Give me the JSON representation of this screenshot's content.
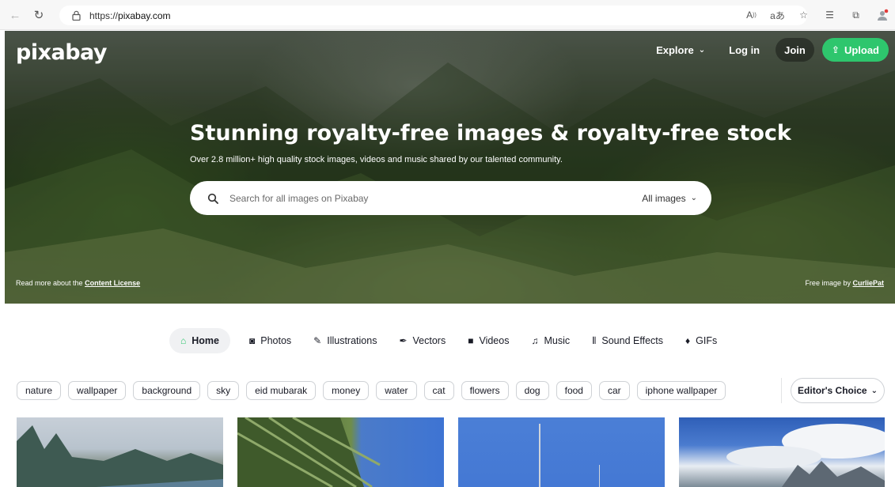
{
  "browser": {
    "url_prefix": "https://",
    "url_host": "pixabay.com",
    "icons": [
      "read-aloud-icon",
      "translate-icon",
      "favorite-star-icon",
      "favorites-list-icon",
      "collections-icon",
      "profile-icon"
    ]
  },
  "header": {
    "logo": "pixabay",
    "explore_label": "Explore",
    "login_label": "Log in",
    "join_label": "Join",
    "upload_label": "Upload"
  },
  "hero": {
    "title": "Stunning royalty-free images & royalty-free stock",
    "subtitle": "Over 2.8 million+ high quality stock images, videos and music shared by our talented community.",
    "search_placeholder": "Search for all images on Pixabay",
    "search_scope": "All images",
    "license_prefix": "Read more about the",
    "license_link": "Content License",
    "credit_prefix": "Free image by",
    "credit_link": "CurliePat"
  },
  "tabs": [
    {
      "label": "Home",
      "icon": "home-icon",
      "active": true
    },
    {
      "label": "Photos",
      "icon": "camera-icon",
      "active": false
    },
    {
      "label": "Illustrations",
      "icon": "brush-icon",
      "active": false
    },
    {
      "label": "Vectors",
      "icon": "pen-nib-icon",
      "active": false
    },
    {
      "label": "Videos",
      "icon": "video-camera-icon",
      "active": false
    },
    {
      "label": "Music",
      "icon": "music-note-icon",
      "active": false
    },
    {
      "label": "Sound Effects",
      "icon": "sound-wave-icon",
      "active": false
    },
    {
      "label": "GIFs",
      "icon": "gif-icon",
      "active": false
    }
  ],
  "chips": [
    "nature",
    "wallpaper",
    "background",
    "sky",
    "eid mubarak",
    "money",
    "water",
    "cat",
    "flowers",
    "dog",
    "food",
    "car",
    "iphone wallpaper"
  ],
  "filter": {
    "editors_choice_label": "Editor's Choice"
  },
  "colors": {
    "accent": "#2ec66d",
    "text": "#191b26",
    "chip_border": "#cfd2d6"
  }
}
